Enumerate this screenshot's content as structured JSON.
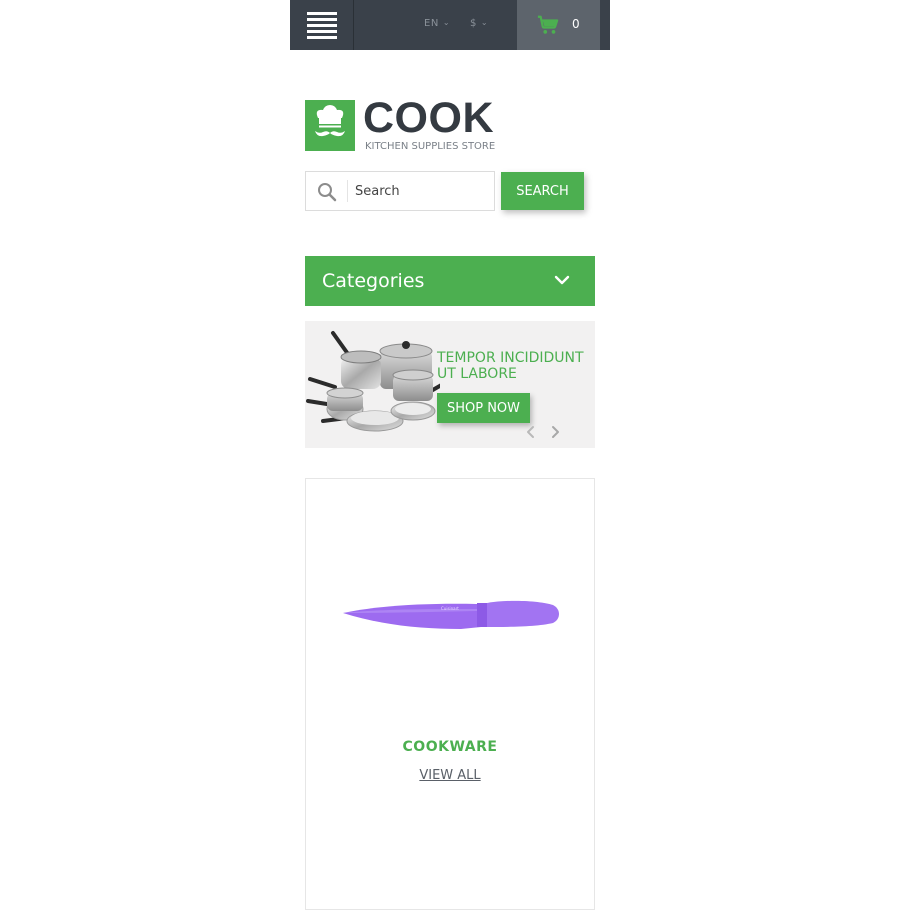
{
  "topbar": {
    "language": "EN",
    "currency": "$",
    "cart_count": "0"
  },
  "logo": {
    "title": "COOK",
    "subtitle": "KITCHEN SUPPLIES STORE"
  },
  "search": {
    "placeholder": "Search",
    "button_label": "SEARCH"
  },
  "categories": {
    "label": "Categories"
  },
  "banner": {
    "headline": "TEMPOR INCIDIDUNT UT LABORE",
    "button_label": "SHOP NOW"
  },
  "card": {
    "title": "COOKWARE",
    "link_label": "VIEW ALL"
  },
  "colors": {
    "accent": "#4caf50",
    "topbar": "#3a414a",
    "cart_bg": "#5d646c",
    "knife": "#9d6bf0"
  },
  "icons": [
    "menu-icon",
    "chevron-down-icon",
    "cart-icon",
    "chef-logo-icon",
    "search-icon",
    "arrow-left-icon",
    "arrow-right-icon"
  ]
}
